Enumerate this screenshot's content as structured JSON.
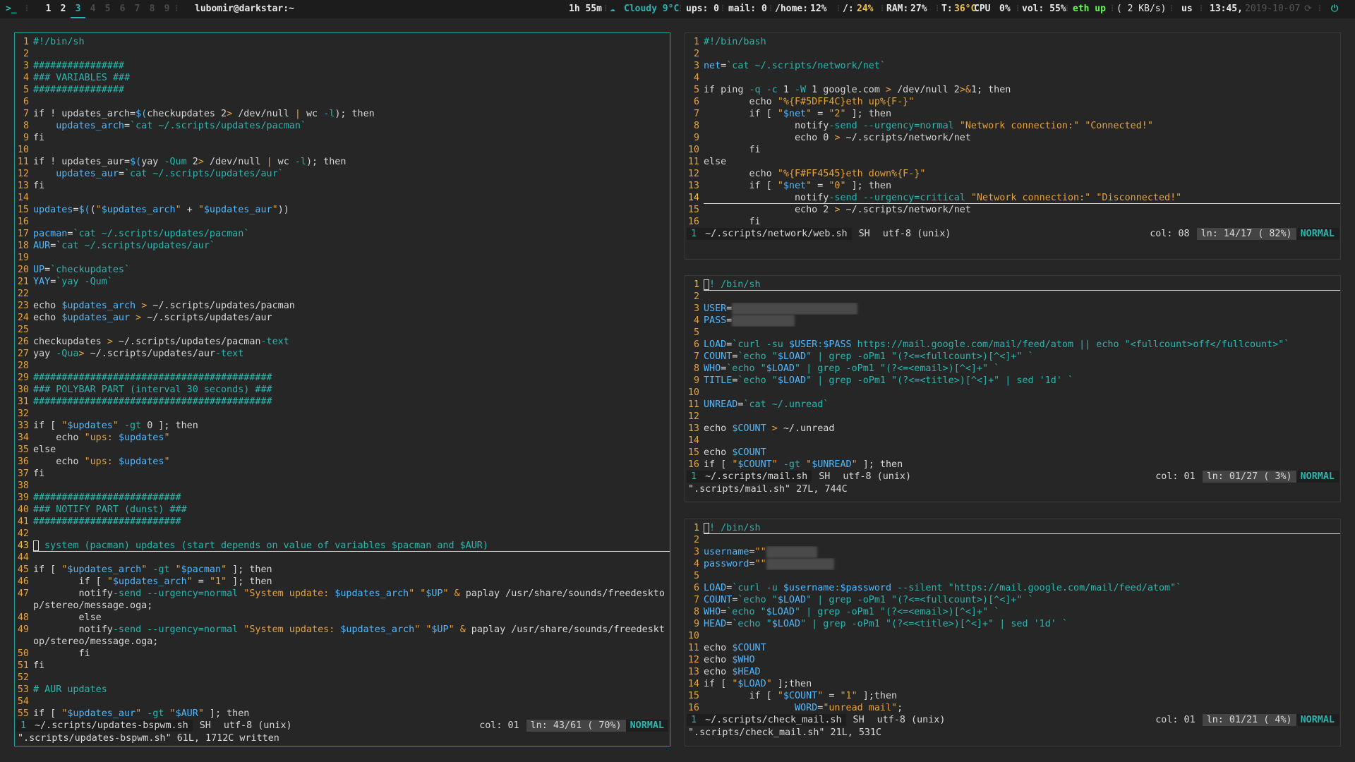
{
  "topbar": {
    "launcher": ">_",
    "workspaces": [
      "1",
      "2",
      "3",
      "4",
      "5",
      "6",
      "7",
      "8",
      "9"
    ],
    "active_workspace": "3",
    "user_host": "lubomir@darkstar:~",
    "uptime": "1h 55m",
    "weather": "Cloudy 9°C",
    "updates": "ups: 0",
    "mail": "mail: 0",
    "home_label": "/home:",
    "home_value": "12%",
    "root_label": "/:",
    "root_value": "24%",
    "ram_label": "RAM:",
    "ram_value": "27%",
    "temp_label": "T:",
    "temp_value": "36°C",
    "cpu_label": "CPU",
    "cpu_value": "0%",
    "vol": "vol: 55%",
    "eth": "eth up",
    "eth_speed": "( 2 KB/s)",
    "kbd_layout": "us",
    "time": "13:45,",
    "date": "2019-10-07",
    "icons": [
      "cloud-icon",
      "refresh-icon",
      "power-icon"
    ]
  },
  "windows": {
    "left": {
      "file": "~/.scripts/updates-bspwm.sh",
      "filetype": "SH",
      "encoding": "utf-8 (unix)",
      "col": "col: 01",
      "ln": "ln: 43/61 ( 70%)",
      "mode": "NORMAL",
      "buffer_no": "1",
      "message": "\".scripts/updates-bspwm.sh\" 61L, 1712C written",
      "lines": [
        "#!/bin/sh",
        "",
        "################",
        "### VARIABLES ###",
        "################",
        "",
        "if ! updates_arch=$(checkupdates 2> /dev/null | wc -l); then",
        "    updates_arch=`cat ~/.scripts/updates/pacman`",
        "fi",
        "",
        "if ! updates_aur=$(yay -Qum 2> /dev/null | wc -l); then",
        "    updates_aur=`cat ~/.scripts/updates/aur`",
        "fi",
        "",
        "updates=$((\"$updates_arch\" + \"$updates_aur\"))",
        "",
        "pacman=`cat ~/.scripts/updates/pacman`",
        "AUR=`cat ~/.scripts/updates/aur`",
        "",
        "UP=`checkupdates`",
        "YAY=`yay -Qum`",
        "",
        "echo $updates_arch > ~/.scripts/updates/pacman",
        "echo $updates_aur > ~/.scripts/updates/aur",
        "",
        "checkupdates > ~/.scripts/updates/pacman-text",
        "yay -Qua> ~/.scripts/updates/aur-text",
        "",
        "##########################################",
        "### POLYBAR PART (interval 30 seconds) ###",
        "##########################################",
        "",
        "if [ \"$updates\" -gt 0 ]; then",
        "    echo \"ups: $updates\"",
        "else",
        "    echo \"ups: $updates\"",
        "fi",
        "",
        "##########################",
        "### NOTIFY PART (dunst) ###",
        "##########################",
        "",
        "# system (pacman) updates (start depends on value of variables $pacman and $AUR)",
        "",
        "if [ \"$updates_arch\" -gt \"$pacman\" ]; then",
        "        if [ \"$updates_arch\" = \"1\" ]; then",
        "        notify-send --urgency=normal \"System update: $updates_arch\" \"$UP\" & paplay /usr/share/sounds/freedeskto\np/stereo/message.oga;",
        "        else",
        "        notify-send --urgency=normal \"System updates: $updates_arch\" \"$UP\" & paplay /usr/share/sounds/freedeskt\nop/stereo/message.oga;",
        "        fi",
        "fi",
        "",
        "# AUR updates",
        "",
        "if [ \"$updates_aur\" -gt \"$AUR\" ]; then"
      ]
    },
    "web": {
      "file": "~/.scripts/network/web.sh",
      "filetype": "SH",
      "encoding": "utf-8 (unix)",
      "col": "col: 08",
      "ln": "ln: 14/17 ( 82%)",
      "mode": "NORMAL",
      "buffer_no": "1",
      "lines": [
        "#!/bin/bash",
        "",
        "net=`cat ~/.scripts/network/net`",
        "",
        "if ping -q -c 1 -W 1 google.com > /dev/null 2>&1; then",
        "        echo \"%{F#5DFF4C}eth up%{F-}\"",
        "        if [ \"$net\" = \"2\" ]; then",
        "                notify-send --urgency=normal \"Network connection:\" \"Connected!\"",
        "                echo 0 > ~/.scripts/network/net",
        "        fi",
        "else",
        "        echo \"%{F#FF4545}eth down%{F-}\"",
        "        if [ \"$net\" = \"0\" ]; then",
        "                notify-send --urgency=critical \"Network connection:\" \"Disconnected!\"",
        "                echo 2 > ~/.scripts/network/net",
        "        fi"
      ]
    },
    "mail": {
      "file": "~/.scripts/mail.sh",
      "filetype": "SH",
      "encoding": "utf-8 (unix)",
      "col": "col: 01",
      "ln": "ln: 01/27 ( 3%)",
      "mode": "NORMAL",
      "buffer_no": "1",
      "message": "\".scripts/mail.sh\" 27L, 744C",
      "lines": [
        "#! /bin/sh",
        "",
        "USER=",
        "PASS=",
        "",
        "LOAD=`curl -su $USER:$PASS https://mail.google.com/mail/feed/atom || echo \"<fullcount>off</fullcount>\"`",
        "COUNT=`echo \"$LOAD\" | grep -oPm1 \"(?<=<fullcount>)[^<]+\" `",
        "WHO=`echo \"$LOAD\" | grep -oPm1 \"(?<=<email>)[^<]+\" `",
        "TITLE=`echo \"$LOAD\" | grep -oPm1 \"(?<=<title>)[^<]+\" | sed '1d' `",
        "",
        "UNREAD=`cat ~/.unread`",
        "",
        "echo $COUNT > ~/.unread",
        "",
        "echo $COUNT",
        "if [ \"$COUNT\" -gt \"$UNREAD\" ]; then"
      ]
    },
    "check": {
      "file": "~/.scripts/check_mail.sh",
      "filetype": "SH",
      "encoding": "utf-8 (unix)",
      "col": "col: 01",
      "ln": "ln: 01/21 ( 4%)",
      "mode": "NORMAL",
      "buffer_no": "1",
      "message": "\".scripts/check_mail.sh\" 21L, 531C",
      "lines": [
        "#! /bin/sh",
        "",
        "username=\"\"",
        "password=\"\"",
        "",
        "LOAD=`curl -u $username:$password --silent \"https://mail.google.com/mail/feed/atom\"`",
        "COUNT=`echo \"$LOAD\" | grep -oPm1 \"(?<=<fullcount>)[^<]+\" `",
        "WHO=`echo \"$LOAD\" | grep -oPm1 \"(?<=<email>)[^<]+\" `",
        "HEAD=`echo \"$LOAD\" | grep -oPm1 \"(?<=<title>)[^<]+\" | sed '1d' `",
        "",
        "echo $COUNT",
        "echo $WHO",
        "echo $HEAD",
        "if [ \"$LOAD\" ];then",
        "        if [ \"$COUNT\" = \"1\" ];then",
        "                WORD=\"unread mail\";"
      ]
    }
  }
}
